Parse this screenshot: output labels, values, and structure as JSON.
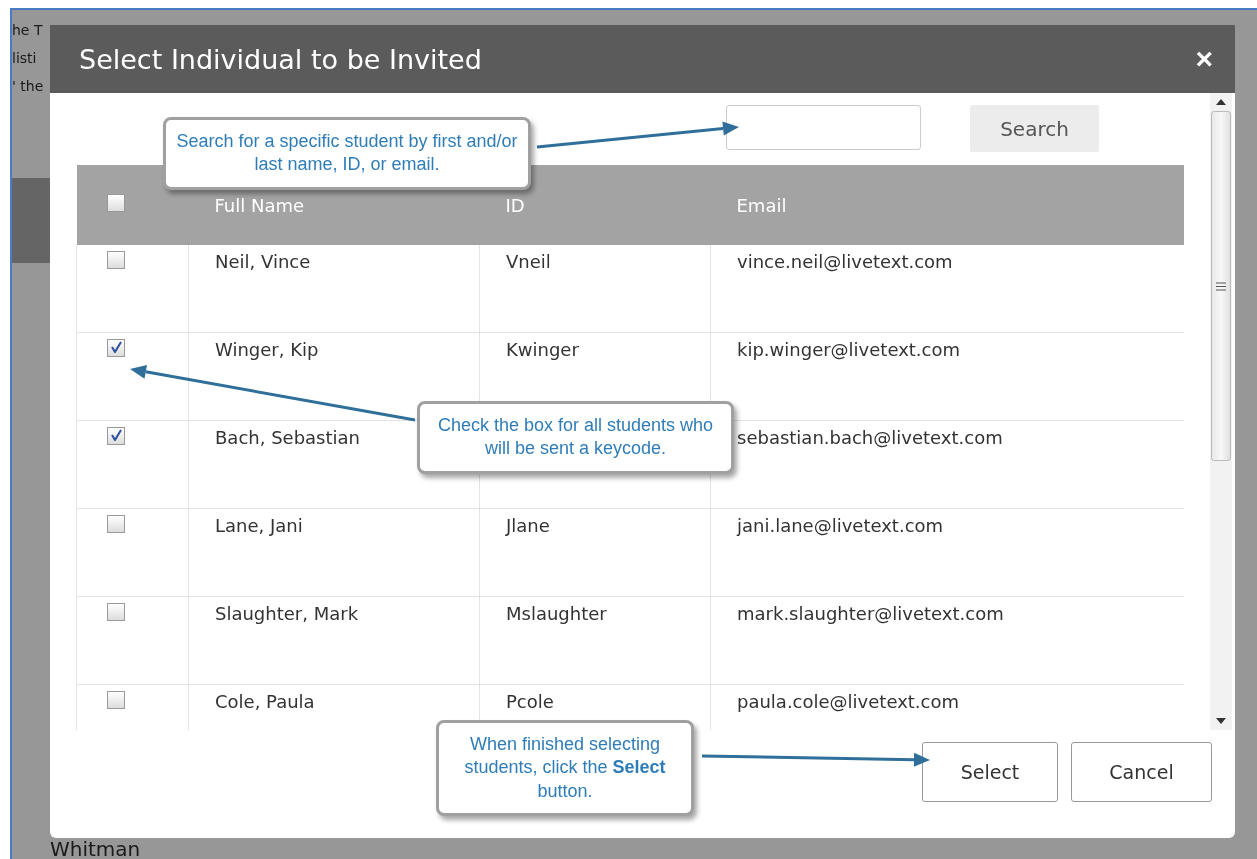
{
  "background": {
    "texts": [
      "he T",
      "listi",
      "' the",
      "Whitman"
    ]
  },
  "dialog": {
    "title": "Select Individual to be Invited",
    "close": "×"
  },
  "search": {
    "button": "Search"
  },
  "table": {
    "header_checked": false,
    "columns": [
      "Full Name",
      "ID",
      "Email"
    ],
    "rows": [
      {
        "checked": false,
        "name": "Neil, Vince",
        "id": "Vneil",
        "email": "vince.neil@livetext.com"
      },
      {
        "checked": true,
        "name": "Winger, Kip",
        "id": "Kwinger",
        "email": "kip.winger@livetext.com"
      },
      {
        "checked": true,
        "name": "Bach, Sebastian",
        "id": "",
        "email": "sebastian.bach@livetext.com"
      },
      {
        "checked": false,
        "name": "Lane, Jani",
        "id": "Jlane",
        "email": "jani.lane@livetext.com"
      },
      {
        "checked": false,
        "name": "Slaughter, Mark",
        "id": "Mslaughter",
        "email": "mark.slaughter@livetext.com"
      },
      {
        "checked": false,
        "name": "Cole, Paula",
        "id": "Pcole",
        "email": "paula.cole@livetext.com"
      }
    ]
  },
  "buttons": [
    "Select",
    "Cancel"
  ],
  "annotations": [
    "Search for a specific student by first and/or last name, ID, or email.",
    "Check the box for all students who will be sent a keycode.",
    "When finished selecting students, click the **Select** button."
  ]
}
